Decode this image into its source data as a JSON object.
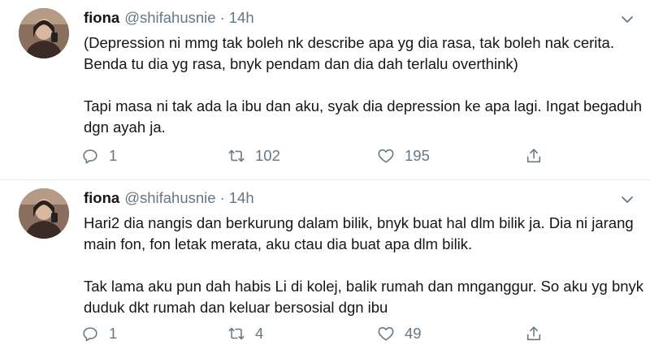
{
  "tweets": [
    {
      "display_name": "fiona",
      "handle": "@shifahusnie",
      "separator": "·",
      "time": "14h",
      "text_p1": "(Depression ni mmg tak boleh nk describe apa yg dia rasa, tak boleh nak cerita. Benda tu dia yg rasa, bnyk pendam dan dia dah terlalu overthink)",
      "text_p2": "Tapi masa ni tak ada la ibu dan aku, syak dia depression ke apa lagi. Ingat begaduh dgn ayah ja.",
      "reply_count": "1",
      "retweet_count": "102",
      "like_count": "195"
    },
    {
      "display_name": "fiona",
      "handle": "@shifahusnie",
      "separator": "·",
      "time": "14h",
      "text_p1": "Hari2 dia nangis dan berkurung dalam bilik, bnyk buat hal dlm bilik ja. Dia ni jarang main fon, fon letak merata, aku ctau dia buat apa dlm bilik.",
      "text_p2": "Tak lama aku pun dah habis Li di kolej, balik rumah dan mnganggur. So aku yg bnyk duduk dkt rumah dan keluar bersosial dgn ibu",
      "reply_count": "1",
      "retweet_count": "4",
      "like_count": "49"
    }
  ],
  "icons": {
    "reply": "reply-icon",
    "retweet": "retweet-icon",
    "like": "like-icon",
    "share": "share-icon",
    "menu": "chevron-down-icon"
  },
  "colors": {
    "text": "#14171a",
    "secondary": "#657786",
    "divider": "#e6ecf0"
  }
}
